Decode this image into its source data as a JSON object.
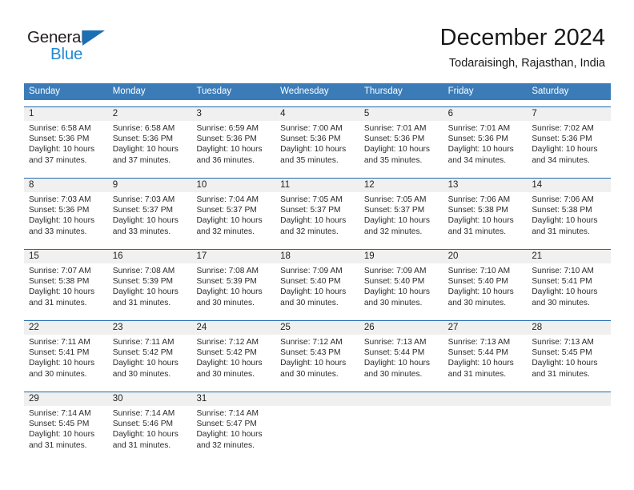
{
  "logo": {
    "word_top": "General",
    "word_bottom": "Blue",
    "triangle_icon": "triangle-icon",
    "accent_dark": "#231f20",
    "accent_blue": "#2389d4"
  },
  "header": {
    "title": "December 2024",
    "subtitle": "Todaraisingh, Rajasthan, India"
  },
  "theme": {
    "header_bg": "#3b7cb8",
    "week_rule": "#1f6aad",
    "daynum_band": "#f0f0f0"
  },
  "weekdays": [
    "Sunday",
    "Monday",
    "Tuesday",
    "Wednesday",
    "Thursday",
    "Friday",
    "Saturday"
  ],
  "weeks": [
    {
      "days": [
        {
          "num": "1",
          "sunrise": "Sunrise: 6:58 AM",
          "sunset": "Sunset: 5:36 PM",
          "daylight_1": "Daylight: 10 hours",
          "daylight_2": "and 37 minutes."
        },
        {
          "num": "2",
          "sunrise": "Sunrise: 6:58 AM",
          "sunset": "Sunset: 5:36 PM",
          "daylight_1": "Daylight: 10 hours",
          "daylight_2": "and 37 minutes."
        },
        {
          "num": "3",
          "sunrise": "Sunrise: 6:59 AM",
          "sunset": "Sunset: 5:36 PM",
          "daylight_1": "Daylight: 10 hours",
          "daylight_2": "and 36 minutes."
        },
        {
          "num": "4",
          "sunrise": "Sunrise: 7:00 AM",
          "sunset": "Sunset: 5:36 PM",
          "daylight_1": "Daylight: 10 hours",
          "daylight_2": "and 35 minutes."
        },
        {
          "num": "5",
          "sunrise": "Sunrise: 7:01 AM",
          "sunset": "Sunset: 5:36 PM",
          "daylight_1": "Daylight: 10 hours",
          "daylight_2": "and 35 minutes."
        },
        {
          "num": "6",
          "sunrise": "Sunrise: 7:01 AM",
          "sunset": "Sunset: 5:36 PM",
          "daylight_1": "Daylight: 10 hours",
          "daylight_2": "and 34 minutes."
        },
        {
          "num": "7",
          "sunrise": "Sunrise: 7:02 AM",
          "sunset": "Sunset: 5:36 PM",
          "daylight_1": "Daylight: 10 hours",
          "daylight_2": "and 34 minutes."
        }
      ]
    },
    {
      "days": [
        {
          "num": "8",
          "sunrise": "Sunrise: 7:03 AM",
          "sunset": "Sunset: 5:36 PM",
          "daylight_1": "Daylight: 10 hours",
          "daylight_2": "and 33 minutes."
        },
        {
          "num": "9",
          "sunrise": "Sunrise: 7:03 AM",
          "sunset": "Sunset: 5:37 PM",
          "daylight_1": "Daylight: 10 hours",
          "daylight_2": "and 33 minutes."
        },
        {
          "num": "10",
          "sunrise": "Sunrise: 7:04 AM",
          "sunset": "Sunset: 5:37 PM",
          "daylight_1": "Daylight: 10 hours",
          "daylight_2": "and 32 minutes."
        },
        {
          "num": "11",
          "sunrise": "Sunrise: 7:05 AM",
          "sunset": "Sunset: 5:37 PM",
          "daylight_1": "Daylight: 10 hours",
          "daylight_2": "and 32 minutes."
        },
        {
          "num": "12",
          "sunrise": "Sunrise: 7:05 AM",
          "sunset": "Sunset: 5:37 PM",
          "daylight_1": "Daylight: 10 hours",
          "daylight_2": "and 32 minutes."
        },
        {
          "num": "13",
          "sunrise": "Sunrise: 7:06 AM",
          "sunset": "Sunset: 5:38 PM",
          "daylight_1": "Daylight: 10 hours",
          "daylight_2": "and 31 minutes."
        },
        {
          "num": "14",
          "sunrise": "Sunrise: 7:06 AM",
          "sunset": "Sunset: 5:38 PM",
          "daylight_1": "Daylight: 10 hours",
          "daylight_2": "and 31 minutes."
        }
      ]
    },
    {
      "days": [
        {
          "num": "15",
          "sunrise": "Sunrise: 7:07 AM",
          "sunset": "Sunset: 5:38 PM",
          "daylight_1": "Daylight: 10 hours",
          "daylight_2": "and 31 minutes."
        },
        {
          "num": "16",
          "sunrise": "Sunrise: 7:08 AM",
          "sunset": "Sunset: 5:39 PM",
          "daylight_1": "Daylight: 10 hours",
          "daylight_2": "and 31 minutes."
        },
        {
          "num": "17",
          "sunrise": "Sunrise: 7:08 AM",
          "sunset": "Sunset: 5:39 PM",
          "daylight_1": "Daylight: 10 hours",
          "daylight_2": "and 30 minutes."
        },
        {
          "num": "18",
          "sunrise": "Sunrise: 7:09 AM",
          "sunset": "Sunset: 5:40 PM",
          "daylight_1": "Daylight: 10 hours",
          "daylight_2": "and 30 minutes."
        },
        {
          "num": "19",
          "sunrise": "Sunrise: 7:09 AM",
          "sunset": "Sunset: 5:40 PM",
          "daylight_1": "Daylight: 10 hours",
          "daylight_2": "and 30 minutes."
        },
        {
          "num": "20",
          "sunrise": "Sunrise: 7:10 AM",
          "sunset": "Sunset: 5:40 PM",
          "daylight_1": "Daylight: 10 hours",
          "daylight_2": "and 30 minutes."
        },
        {
          "num": "21",
          "sunrise": "Sunrise: 7:10 AM",
          "sunset": "Sunset: 5:41 PM",
          "daylight_1": "Daylight: 10 hours",
          "daylight_2": "and 30 minutes."
        }
      ]
    },
    {
      "days": [
        {
          "num": "22",
          "sunrise": "Sunrise: 7:11 AM",
          "sunset": "Sunset: 5:41 PM",
          "daylight_1": "Daylight: 10 hours",
          "daylight_2": "and 30 minutes."
        },
        {
          "num": "23",
          "sunrise": "Sunrise: 7:11 AM",
          "sunset": "Sunset: 5:42 PM",
          "daylight_1": "Daylight: 10 hours",
          "daylight_2": "and 30 minutes."
        },
        {
          "num": "24",
          "sunrise": "Sunrise: 7:12 AM",
          "sunset": "Sunset: 5:42 PM",
          "daylight_1": "Daylight: 10 hours",
          "daylight_2": "and 30 minutes."
        },
        {
          "num": "25",
          "sunrise": "Sunrise: 7:12 AM",
          "sunset": "Sunset: 5:43 PM",
          "daylight_1": "Daylight: 10 hours",
          "daylight_2": "and 30 minutes."
        },
        {
          "num": "26",
          "sunrise": "Sunrise: 7:13 AM",
          "sunset": "Sunset: 5:44 PM",
          "daylight_1": "Daylight: 10 hours",
          "daylight_2": "and 30 minutes."
        },
        {
          "num": "27",
          "sunrise": "Sunrise: 7:13 AM",
          "sunset": "Sunset: 5:44 PM",
          "daylight_1": "Daylight: 10 hours",
          "daylight_2": "and 31 minutes."
        },
        {
          "num": "28",
          "sunrise": "Sunrise: 7:13 AM",
          "sunset": "Sunset: 5:45 PM",
          "daylight_1": "Daylight: 10 hours",
          "daylight_2": "and 31 minutes."
        }
      ]
    },
    {
      "days": [
        {
          "num": "29",
          "sunrise": "Sunrise: 7:14 AM",
          "sunset": "Sunset: 5:45 PM",
          "daylight_1": "Daylight: 10 hours",
          "daylight_2": "and 31 minutes."
        },
        {
          "num": "30",
          "sunrise": "Sunrise: 7:14 AM",
          "sunset": "Sunset: 5:46 PM",
          "daylight_1": "Daylight: 10 hours",
          "daylight_2": "and 31 minutes."
        },
        {
          "num": "31",
          "sunrise": "Sunrise: 7:14 AM",
          "sunset": "Sunset: 5:47 PM",
          "daylight_1": "Daylight: 10 hours",
          "daylight_2": "and 32 minutes."
        },
        {
          "num": "",
          "sunrise": "",
          "sunset": "",
          "daylight_1": "",
          "daylight_2": ""
        },
        {
          "num": "",
          "sunrise": "",
          "sunset": "",
          "daylight_1": "",
          "daylight_2": ""
        },
        {
          "num": "",
          "sunrise": "",
          "sunset": "",
          "daylight_1": "",
          "daylight_2": ""
        },
        {
          "num": "",
          "sunrise": "",
          "sunset": "",
          "daylight_1": "",
          "daylight_2": ""
        }
      ]
    }
  ]
}
